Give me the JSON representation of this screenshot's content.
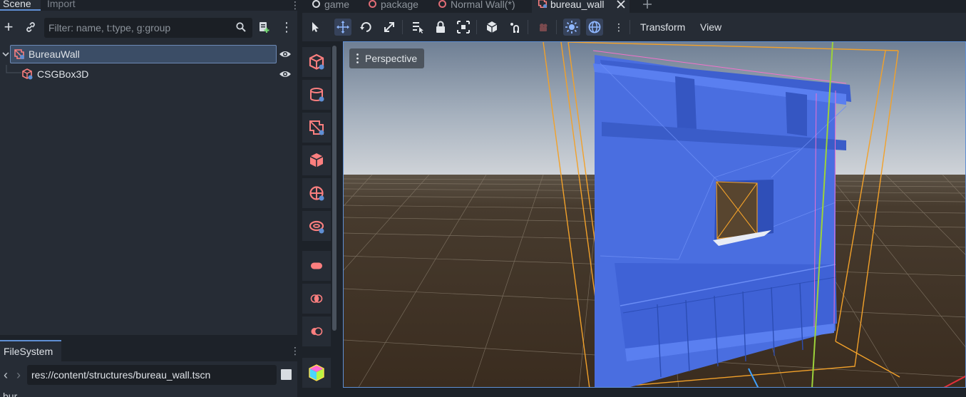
{
  "left_dock": {
    "tabs": [
      {
        "label": "Scene",
        "active": true
      },
      {
        "label": "Import",
        "active": false
      }
    ],
    "toolbar": {
      "filter_placeholder": "Filter: name, t:type, g:group"
    },
    "tree": [
      {
        "label": "BureauWall",
        "icon": "csg-combiner-icon",
        "selected": true,
        "expanded": true
      },
      {
        "label": "CSGBox3D",
        "icon": "csg-box-icon",
        "selected": false
      }
    ]
  },
  "filesystem": {
    "tab_label": "FileSystem",
    "path": "res://content/structures/bureau_wall.tscn",
    "filter_text": "bur"
  },
  "editor_tabs": [
    {
      "label": "game",
      "dot_color": "#d5d9de",
      "active": false
    },
    {
      "label": "package",
      "dot_color": "#e06c75",
      "active": false
    },
    {
      "label": "Normal Wall(*)",
      "dot_color": "#e06c75",
      "active": false
    },
    {
      "label": "bureau_wall",
      "icon": "csg-combiner-icon",
      "active": true
    }
  ],
  "viewport_toolbar": {
    "menus": [
      "Transform",
      "View"
    ]
  },
  "viewport": {
    "perspective_label": "Perspective"
  },
  "colors": {
    "accent": "#5f8fd4",
    "csg_icon": "#fc7f7f",
    "selection_bg": "#3b4d66",
    "wall_blue": "#4a6ee0"
  }
}
